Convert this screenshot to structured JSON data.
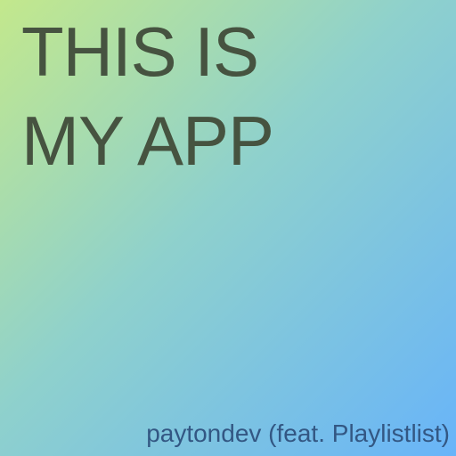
{
  "cover": {
    "title": {
      "line1": "THIS IS",
      "line2": "MY APP"
    },
    "credit": "paytondev (feat. Playlistlist)"
  },
  "colors": {
    "gradient_start": "#c3e88c",
    "gradient_middle": "#8fd1cc",
    "gradient_end": "#68b4f9",
    "title_text": "#465340",
    "credit_text": "#335783"
  }
}
